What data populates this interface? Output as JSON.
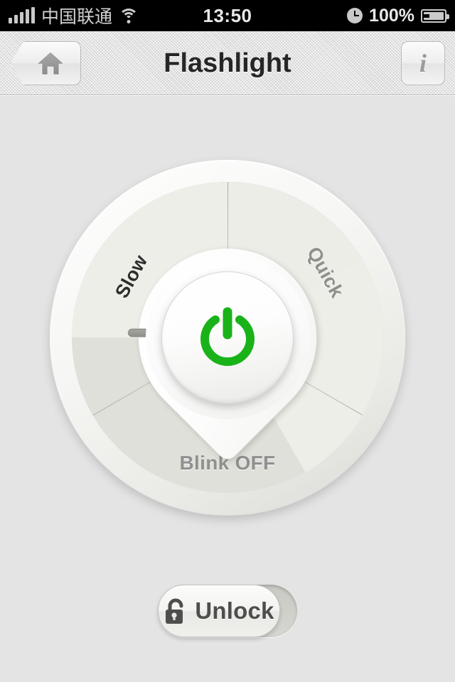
{
  "statusbar": {
    "signal_icon": "signal-bars-icon",
    "carrier": "中国联通",
    "wifi_icon": "wifi-icon",
    "time": "13:50",
    "alarm_icon": "alarm-clock-icon",
    "battery_percent": "100%",
    "battery_icon": "battery-icon"
  },
  "navbar": {
    "title": "Flashlight",
    "home_icon": "home-icon",
    "info_label": "i",
    "info_icon": "info-icon"
  },
  "dial": {
    "selected_mode": "Slow",
    "sectors": [
      {
        "label": "Slow",
        "state": "selected"
      },
      {
        "label": "Quick",
        "state": "inactive"
      },
      {
        "label": "Blink OFF",
        "state": "inactive"
      }
    ],
    "power_icon": "power-icon",
    "power_state": "on",
    "power_color": "#19b319",
    "indicator_icon": "dial-indicator-icon"
  },
  "unlock": {
    "label": "Unlock",
    "lock_icon": "open-padlock-icon",
    "state": "locked"
  },
  "colors": {
    "accent_green": "#19b319",
    "background": "#e3e3e3",
    "sector_selected": "#dfe0d9",
    "sector_inactive": "#edeee8",
    "title_text": "#262626",
    "muted_text": "#909090"
  }
}
